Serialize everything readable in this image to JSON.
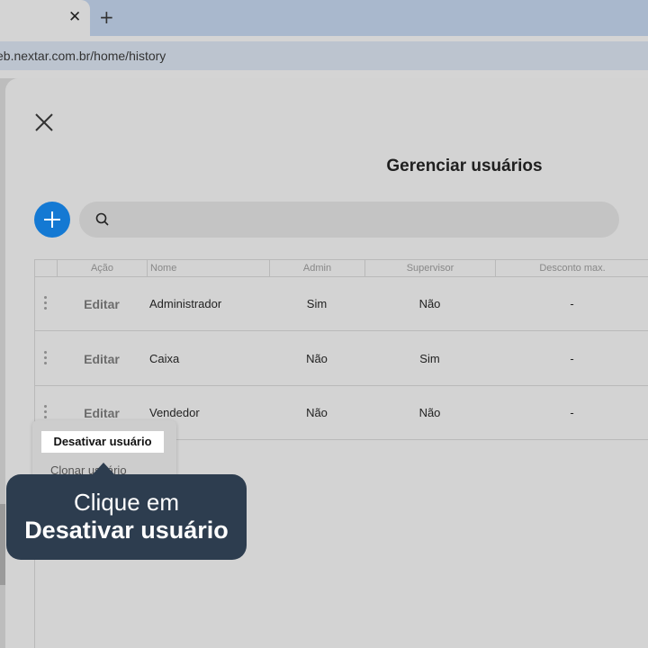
{
  "browser": {
    "tab_close_glyph": "✕",
    "new_tab_glyph": "+",
    "url": "eb.nextar.com.br/home/history"
  },
  "modal": {
    "close_icon": "close-icon",
    "title": "Gerenciar usuários",
    "add_icon": "plus-icon",
    "accent_color": "#1479d3",
    "search": {
      "icon": "search-icon",
      "placeholder": "",
      "value": ""
    }
  },
  "table": {
    "headers": {
      "action": "Ação",
      "name": "Nome",
      "admin": "Admin",
      "supervisor": "Supervisor",
      "discount": "Desconto max."
    },
    "rows": [
      {
        "action": "Editar",
        "name": "Administrador",
        "admin": "Sim",
        "supervisor": "Não",
        "discount": "-"
      },
      {
        "action": "Editar",
        "name": "Caixa",
        "admin": "Não",
        "supervisor": "Sim",
        "discount": "-"
      },
      {
        "action": "Editar",
        "name": "Vendedor",
        "admin": "Não",
        "supervisor": "Não",
        "discount": "-"
      }
    ]
  },
  "context_menu": {
    "items": [
      "Desativar usuário",
      "Clonar usuário"
    ]
  },
  "tooltip": {
    "line1": "Clique em",
    "line2": "Desativar usuário",
    "color": "#2d3d4f"
  }
}
